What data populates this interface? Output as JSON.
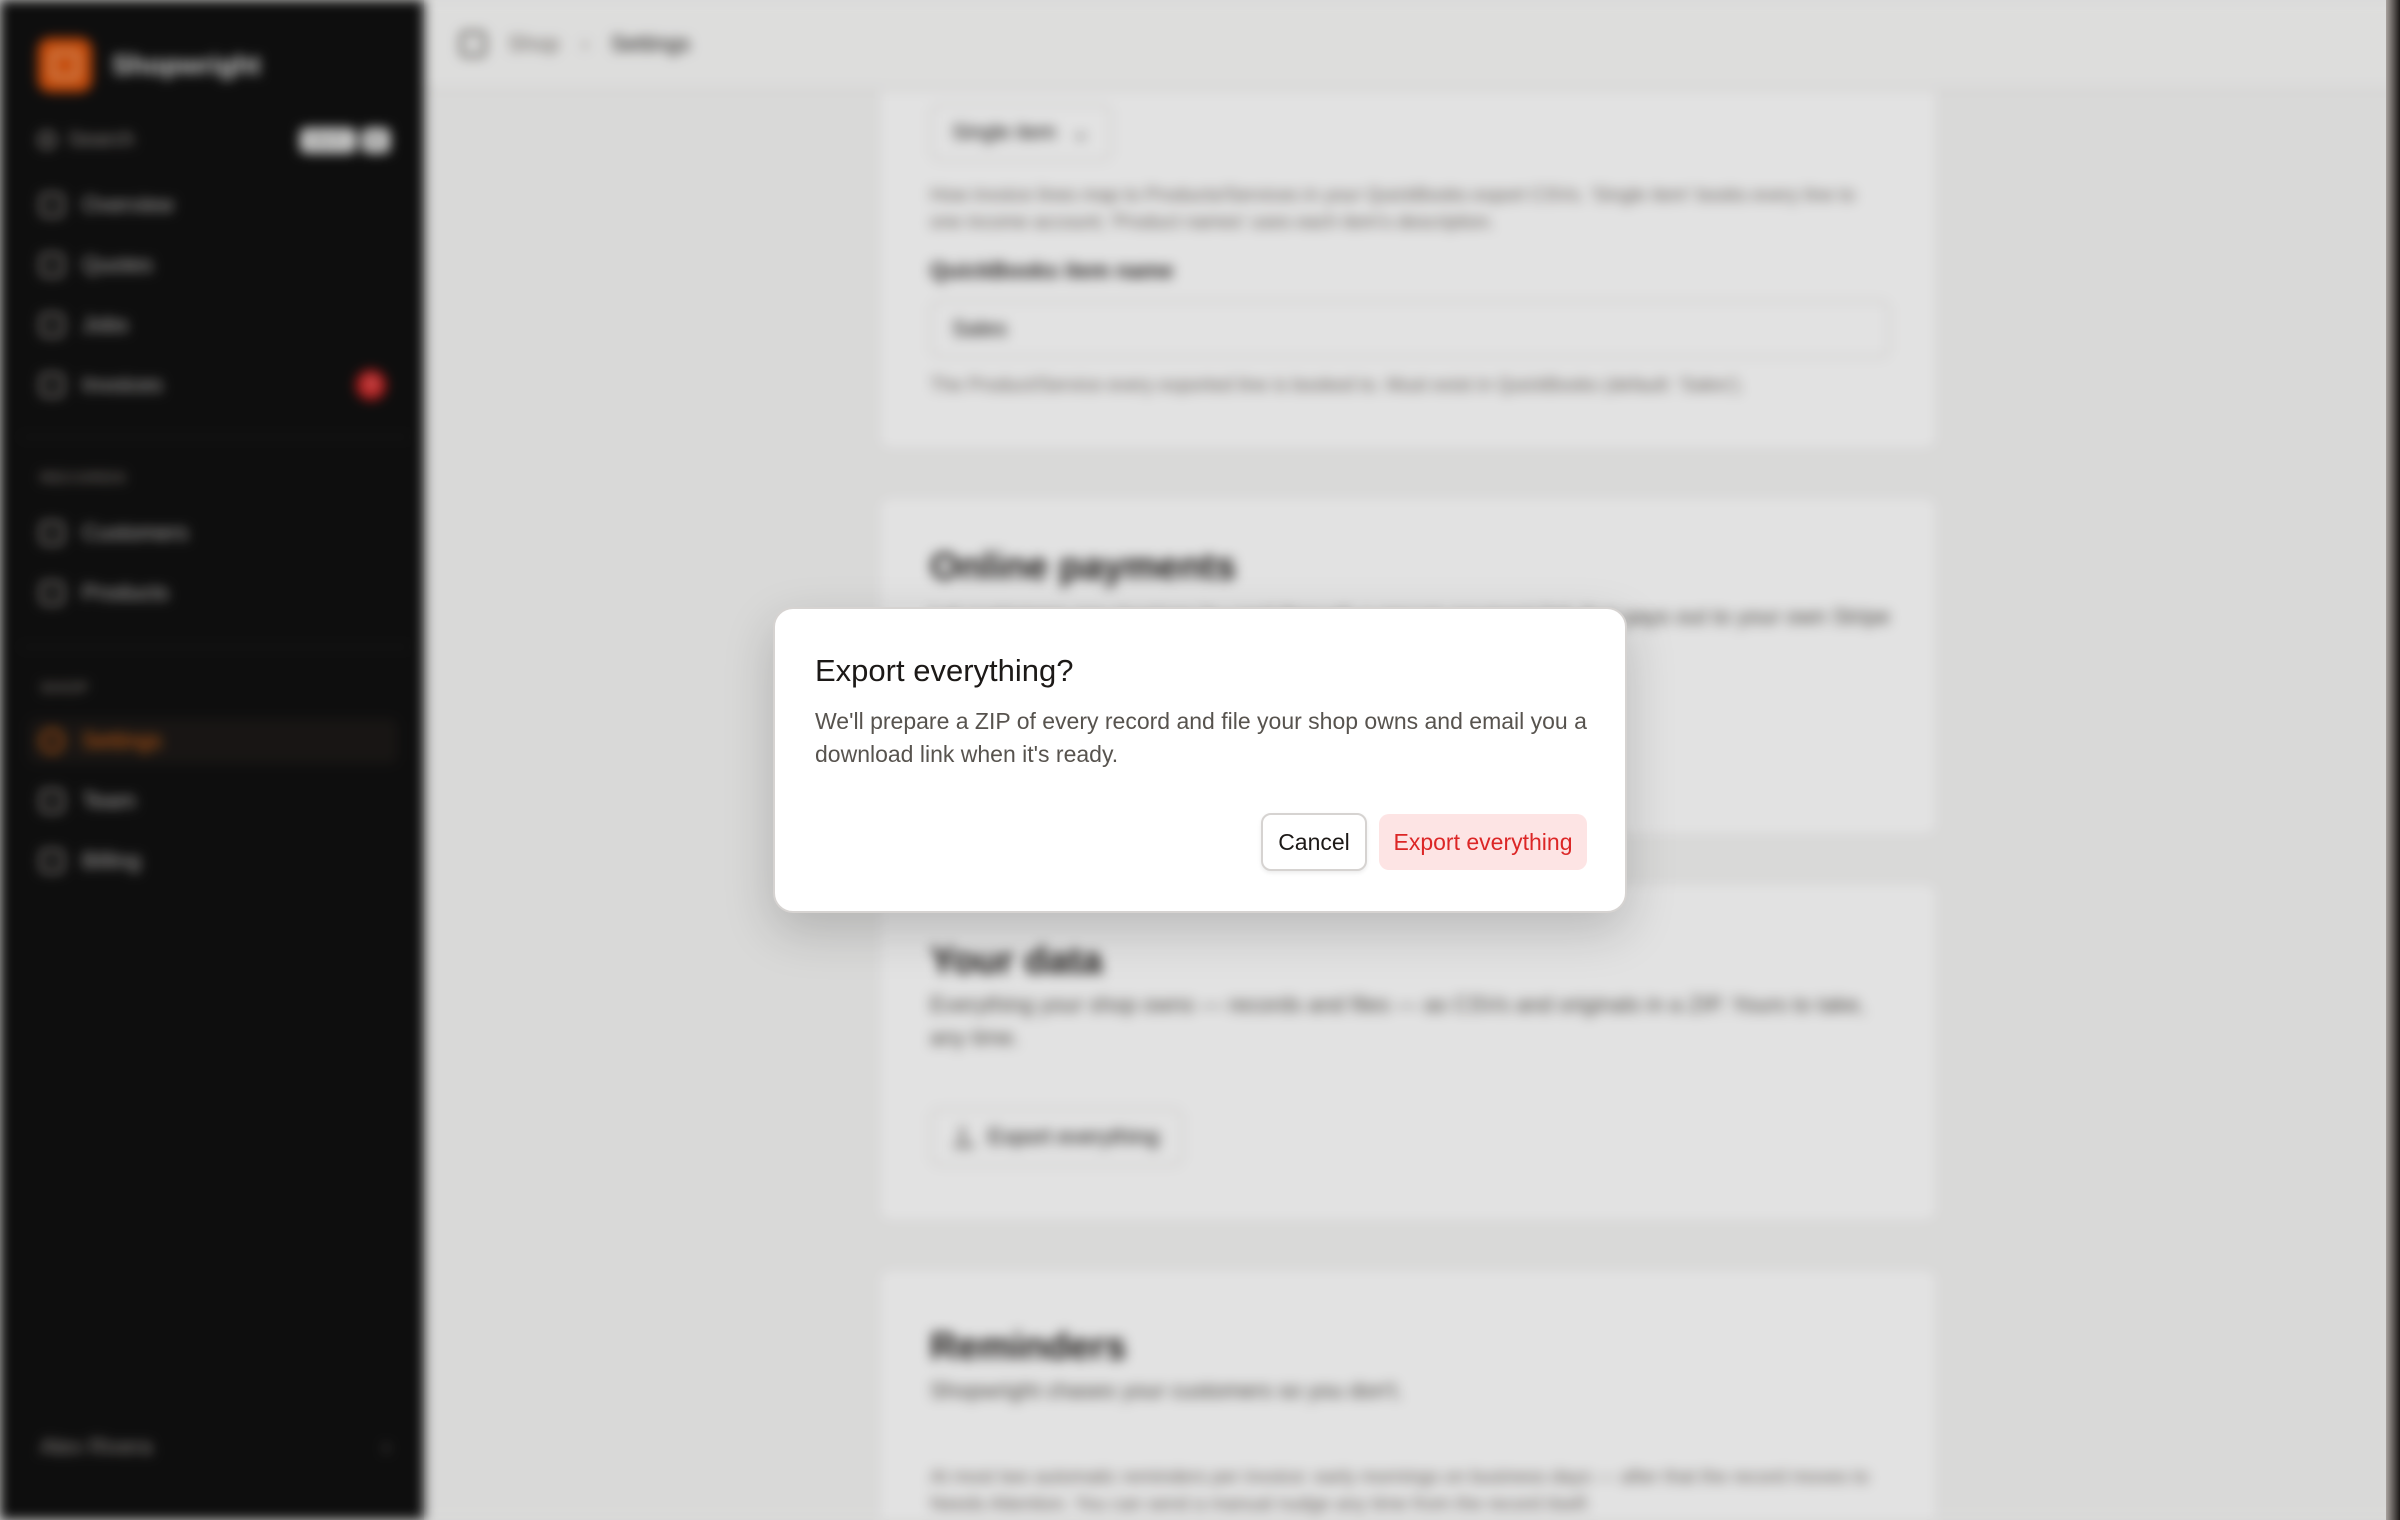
{
  "sidebar": {
    "brand": "Shopwright",
    "search_label": "Search",
    "search_shortcut": [
      "Ctrl",
      "K"
    ],
    "primary_items": [
      {
        "label": "Overview"
      },
      {
        "label": "Quotes"
      },
      {
        "label": "Jobs"
      },
      {
        "label": "Invoices",
        "badge": "3"
      }
    ],
    "records_section": "RECORDS",
    "records_items": [
      {
        "label": "Customers"
      },
      {
        "label": "Products"
      }
    ],
    "shop_section": "SHOP",
    "shop_items": [
      {
        "label": "Settings",
        "active": true
      },
      {
        "label": "Team"
      },
      {
        "label": "Billing"
      }
    ],
    "user_name": "Alex Rivera",
    "user_chevron": "›"
  },
  "topbar": {
    "crumb_root": "Shop",
    "crumb_separator": "›",
    "crumb_current": "Settings"
  },
  "settings": {
    "accounting": {
      "line_mode_value": "Single item",
      "line_mode_help": "How invoice lines map to Products/Services in your QuickBooks export CSVs. 'Single item' books every line to one income account; 'Product names' uses each item's description.",
      "item_name_label": "QuickBooks item name",
      "item_name_value": "Sales",
      "item_name_help": "The Product/Service every exported line is booked to. Must exist in QuickBooks (default: 'Sales')."
    },
    "online_payments": {
      "title": "Online payments",
      "description": "Let customers pay invoices by card through a secure payment link that pays out to your own Stripe account."
    },
    "your_data": {
      "title": "Your data",
      "description": "Everything your shop owns — records and files — as CSVs and originals in a ZIP. Yours to take, any time.",
      "export_button": "Export everything"
    },
    "reminders": {
      "title": "Reminders",
      "description": "Shopwright chases your customers so you don't.",
      "help": "At most two automatic reminders per invoice: early mornings on business days — after that the record moves to Needs Attention. You can send a manual nudge any time from the record itself."
    }
  },
  "dialog": {
    "title": "Export everything?",
    "body": "We'll prepare a ZIP of every record and file your shop owns and email you a download link when it's ready.",
    "cancel_label": "Cancel",
    "confirm_label": "Export everything"
  },
  "colors": {
    "accent": "#ea580c",
    "danger": "#dc2626",
    "danger_bg": "#fde4e4",
    "sidebar_bg": "#0f0f0f"
  }
}
